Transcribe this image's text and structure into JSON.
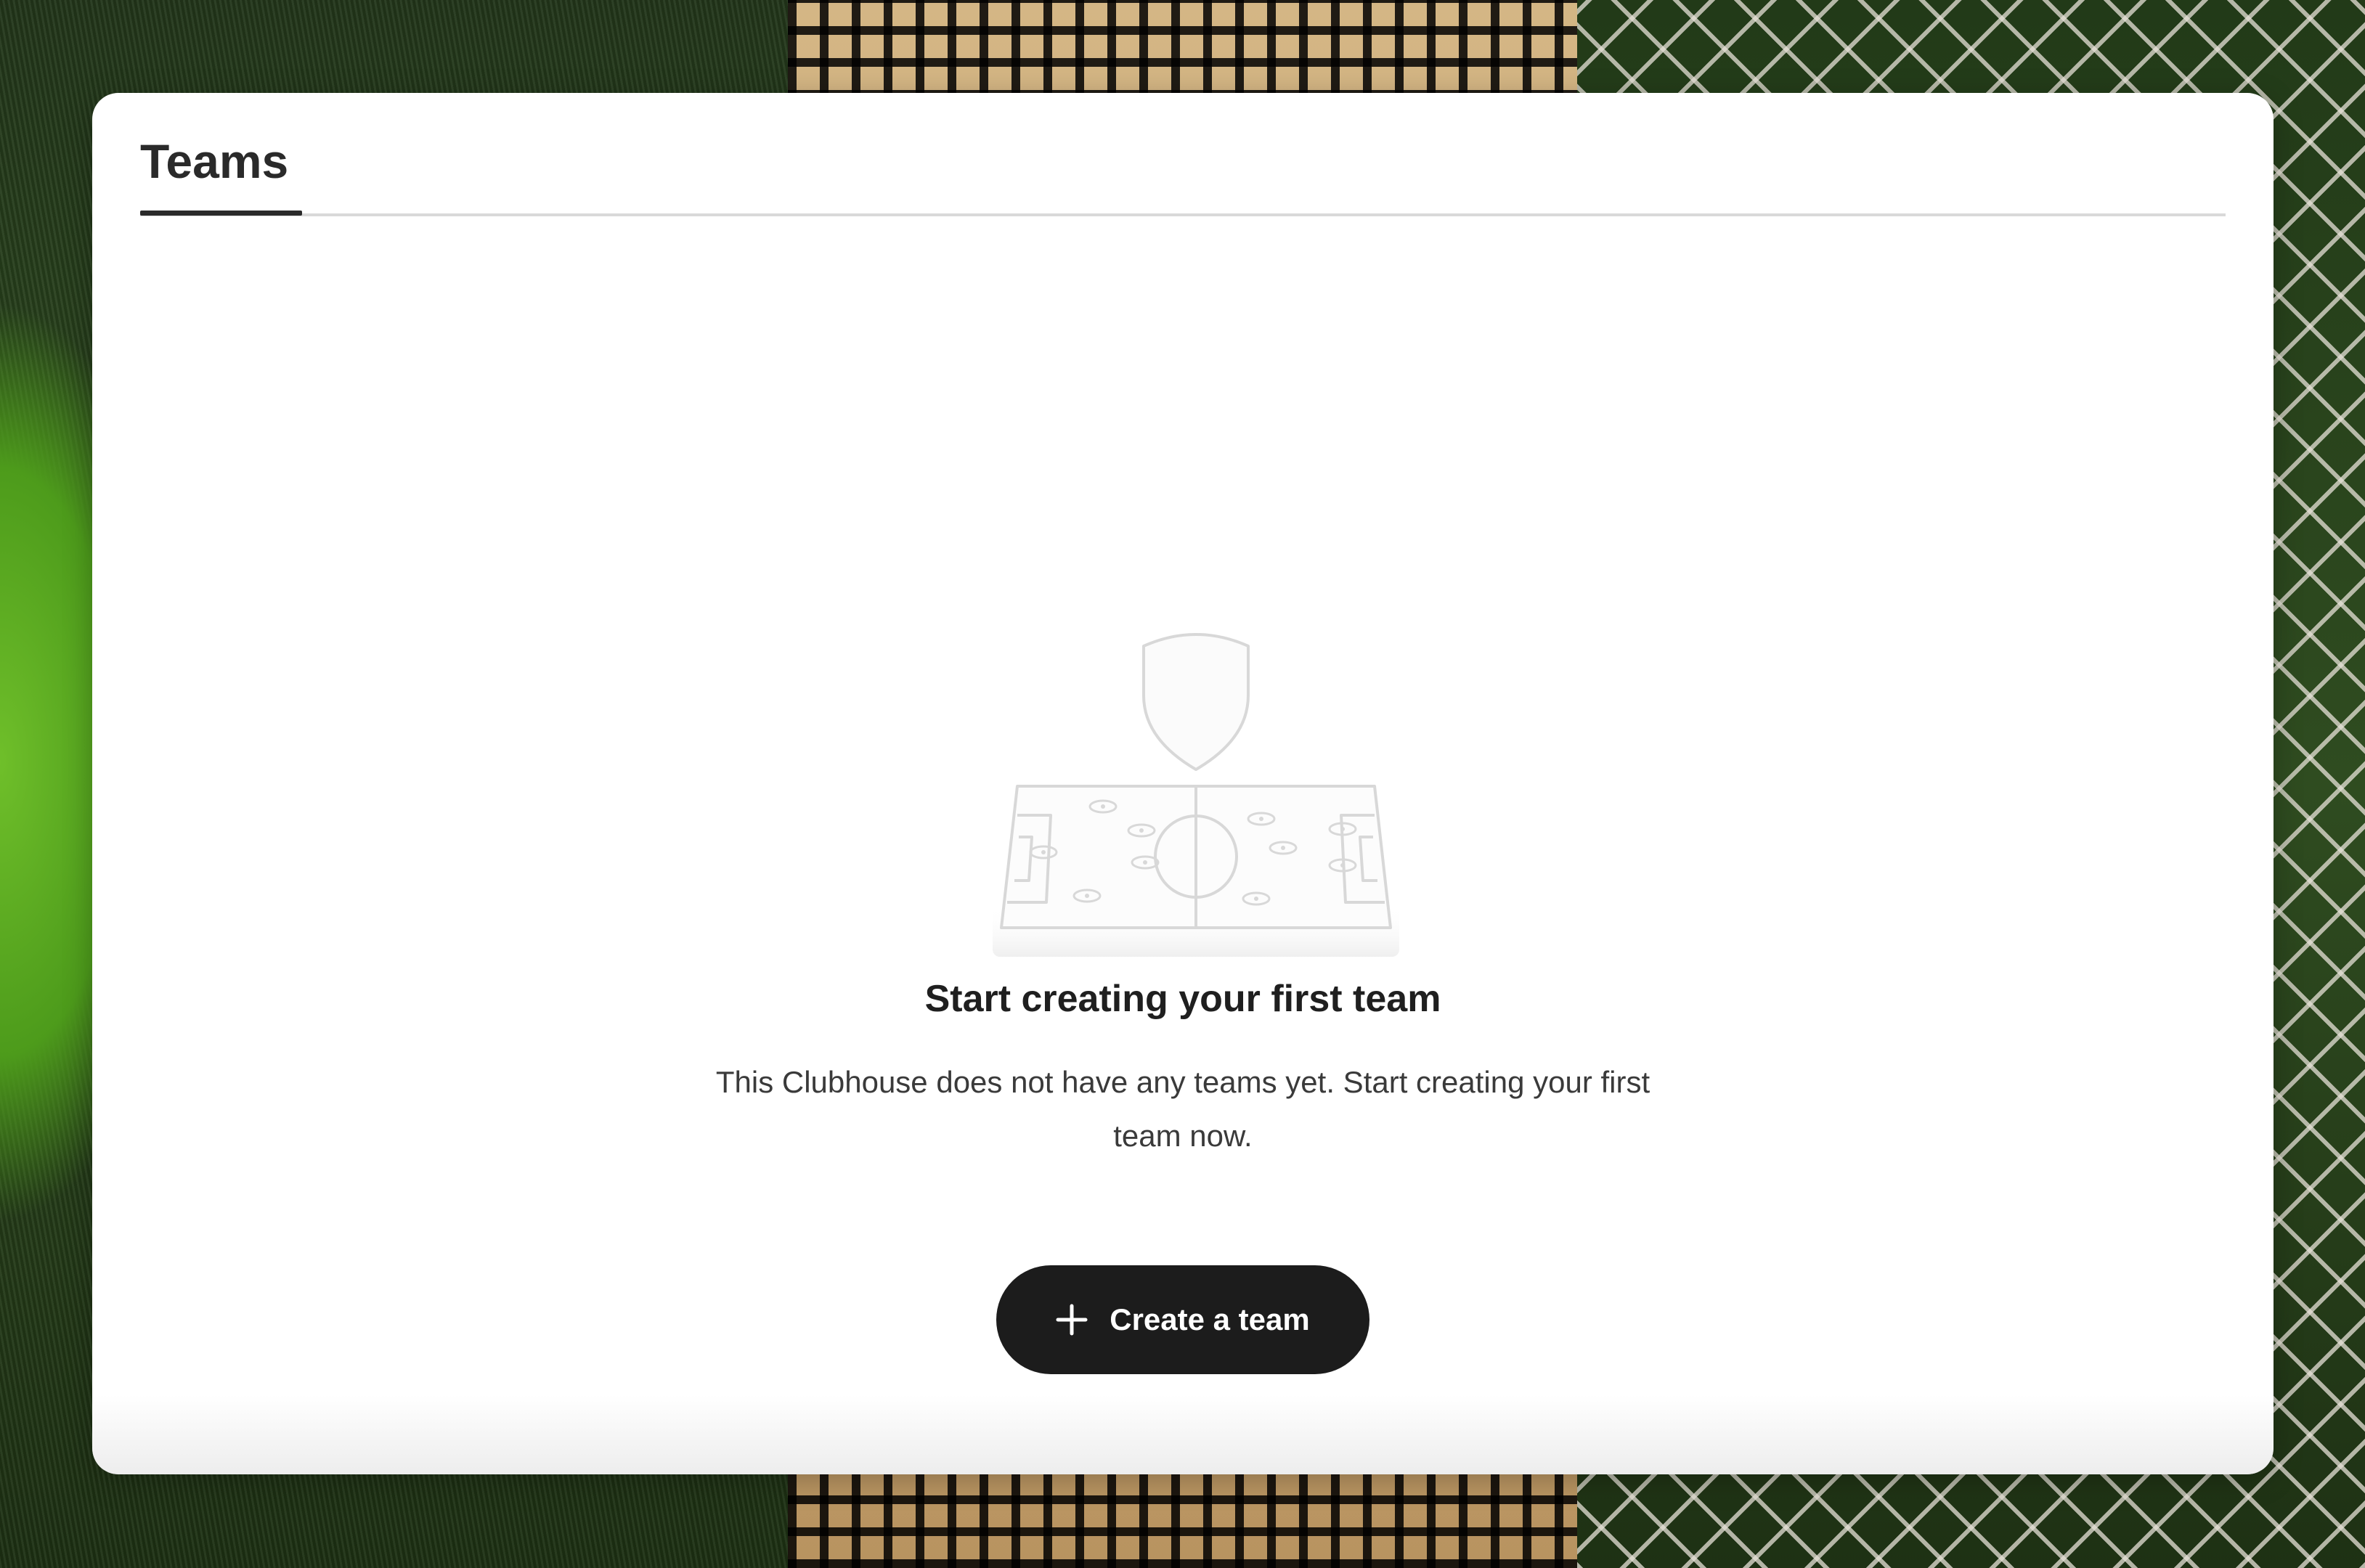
{
  "tabs": [
    {
      "label": "Teams",
      "active": true
    }
  ],
  "empty_state": {
    "illustration": "shield-over-pitch-illustration",
    "title": "Start creating your first team",
    "description": "This Clubhouse does not have any teams yet. Start creating your first team now."
  },
  "create_button": {
    "icon": "plus-icon",
    "label": "Create a team"
  },
  "colors": {
    "button_bg": "#1c1c1c",
    "button_text": "#ffffff",
    "tab_indicator": "#2a2a2a",
    "divider": "#d9d9d9",
    "illustration_stroke": "#d8d8d8"
  }
}
